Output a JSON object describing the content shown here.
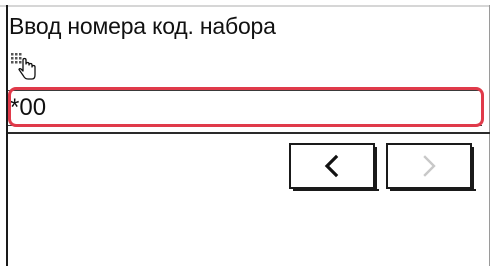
{
  "screen": {
    "title": "Ввод номера код. набора",
    "icon": "keypad-touch-icon",
    "input": {
      "value": "*00"
    },
    "nav": {
      "prev_icon": "chevron-left-icon",
      "next_icon": "chevron-right-icon",
      "next_enabled": false
    }
  },
  "colors": {
    "highlight": "#e03a4a",
    "text": "#111111",
    "disabled": "#c8c8c8"
  }
}
